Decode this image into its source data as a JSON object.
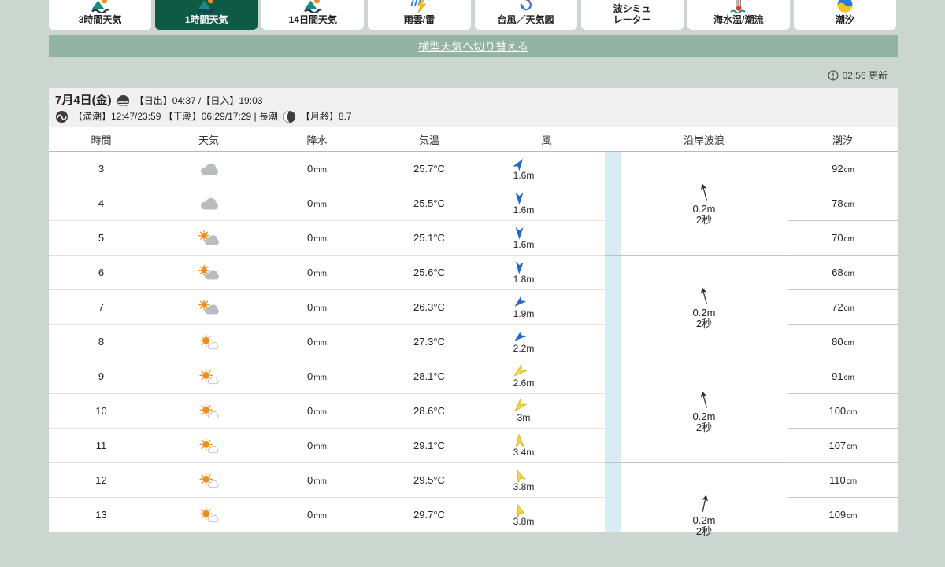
{
  "tabs": [
    {
      "name": "tab-3hour-weather",
      "label": "3時間天気",
      "icon": "scene",
      "selected": false
    },
    {
      "name": "tab-1hour-weather",
      "label": "1時間天気",
      "icon": "scene",
      "selected": true
    },
    {
      "name": "tab-14day-weather",
      "label": "14日間天気",
      "icon": "scene",
      "selected": false
    },
    {
      "name": "tab-rain-radar",
      "label": "雨雲/雷",
      "icon": "rain",
      "selected": false
    },
    {
      "name": "tab-typhoon-map",
      "label": "台風／天気図",
      "icon": "typhoon",
      "selected": false
    },
    {
      "name": "tab-wave-simulator",
      "label": "波シミュ\nレーター",
      "icon": "wavesim",
      "selected": false
    },
    {
      "name": "tab-sea-temp-current",
      "label": "海水温/潮流",
      "icon": "seatemp",
      "selected": false
    },
    {
      "name": "tab-tide",
      "label": "潮汐",
      "icon": "tidec",
      "selected": false
    }
  ],
  "banner": {
    "label": "横型天気へ切り替える"
  },
  "updated": {
    "text": "02:56 更新"
  },
  "date_header": {
    "date": "7月4日(金)",
    "sun_times": "【日出】04:37 /【日入】19:03",
    "tide_times": "【満潮】12:47/23:59 【干潮】06:29/17:29 | 長潮",
    "moon_age": "【月齢】8.7"
  },
  "table": {
    "headers": [
      "時間",
      "天気",
      "降水",
      "気温",
      "風",
      "沿岸波浪",
      "潮汐"
    ],
    "units": {
      "precip": "mm",
      "temp": "°C",
      "wind": "m",
      "tide": "cm"
    },
    "rows": [
      {
        "hour": "3",
        "weather": "cloudy",
        "precip": "0",
        "temp": "25.7",
        "wind_speed": "1.6",
        "wind_deg": 35,
        "wind_color": "blue",
        "tide": "92"
      },
      {
        "hour": "4",
        "weather": "cloudy",
        "precip": "0",
        "temp": "25.5",
        "wind_speed": "1.6",
        "wind_deg": 180,
        "wind_color": "blue",
        "tide": "78"
      },
      {
        "hour": "5",
        "weather": "partly",
        "precip": "0",
        "temp": "25.1",
        "wind_speed": "1.6",
        "wind_deg": 180,
        "wind_color": "blue",
        "tide": "70"
      },
      {
        "hour": "6",
        "weather": "partly",
        "precip": "0",
        "temp": "25.6",
        "wind_speed": "1.8",
        "wind_deg": 183,
        "wind_color": "blue",
        "tide": "68"
      },
      {
        "hour": "7",
        "weather": "partly",
        "precip": "0",
        "temp": "26.3",
        "wind_speed": "1.9",
        "wind_deg": 228,
        "wind_color": "blue",
        "tide": "72"
      },
      {
        "hour": "8",
        "weather": "sunny",
        "precip": "0",
        "temp": "27.3",
        "wind_speed": "2.2",
        "wind_deg": 230,
        "wind_color": "blue",
        "tide": "80"
      },
      {
        "hour": "9",
        "weather": "sunny",
        "precip": "0",
        "temp": "28.1",
        "wind_speed": "2.6",
        "wind_deg": 230,
        "wind_color": "yellow",
        "tide": "91"
      },
      {
        "hour": "10",
        "weather": "sunny",
        "precip": "0",
        "temp": "28.6",
        "wind_speed": "3",
        "wind_deg": 222,
        "wind_color": "yellow",
        "tide": "100"
      },
      {
        "hour": "11",
        "weather": "sunny",
        "precip": "0",
        "temp": "29.1",
        "wind_speed": "3.4",
        "wind_deg": -5,
        "wind_color": "yellow",
        "tide": "107"
      },
      {
        "hour": "12",
        "weather": "sunny",
        "precip": "0",
        "temp": "29.5",
        "wind_speed": "3.8",
        "wind_deg": -25,
        "wind_color": "yellow",
        "tide": "110"
      },
      {
        "hour": "13",
        "weather": "sunny",
        "precip": "0",
        "temp": "29.7",
        "wind_speed": "3.8",
        "wind_deg": -20,
        "wind_color": "yellow",
        "tide": "109"
      }
    ],
    "wave_groups": [
      {
        "height": "0.2m",
        "period": "2秒",
        "deg": -15
      },
      {
        "height": "0.2m",
        "period": "2秒",
        "deg": -15
      },
      {
        "height": "0.2m",
        "period": "2秒",
        "deg": -15
      },
      {
        "height": "0.2m",
        "period": "2秒",
        "deg": 12
      }
    ]
  },
  "colors": {
    "accent": "#0e5a45",
    "banner": "#93b3a4",
    "page-bg": "#cbd6d0",
    "stripe": "#d9ecf6",
    "wind-blue": "#2268cc",
    "wind-yellow": "#f2d73e",
    "sun": "#f08c21",
    "cloud": "#b9bdbf"
  }
}
